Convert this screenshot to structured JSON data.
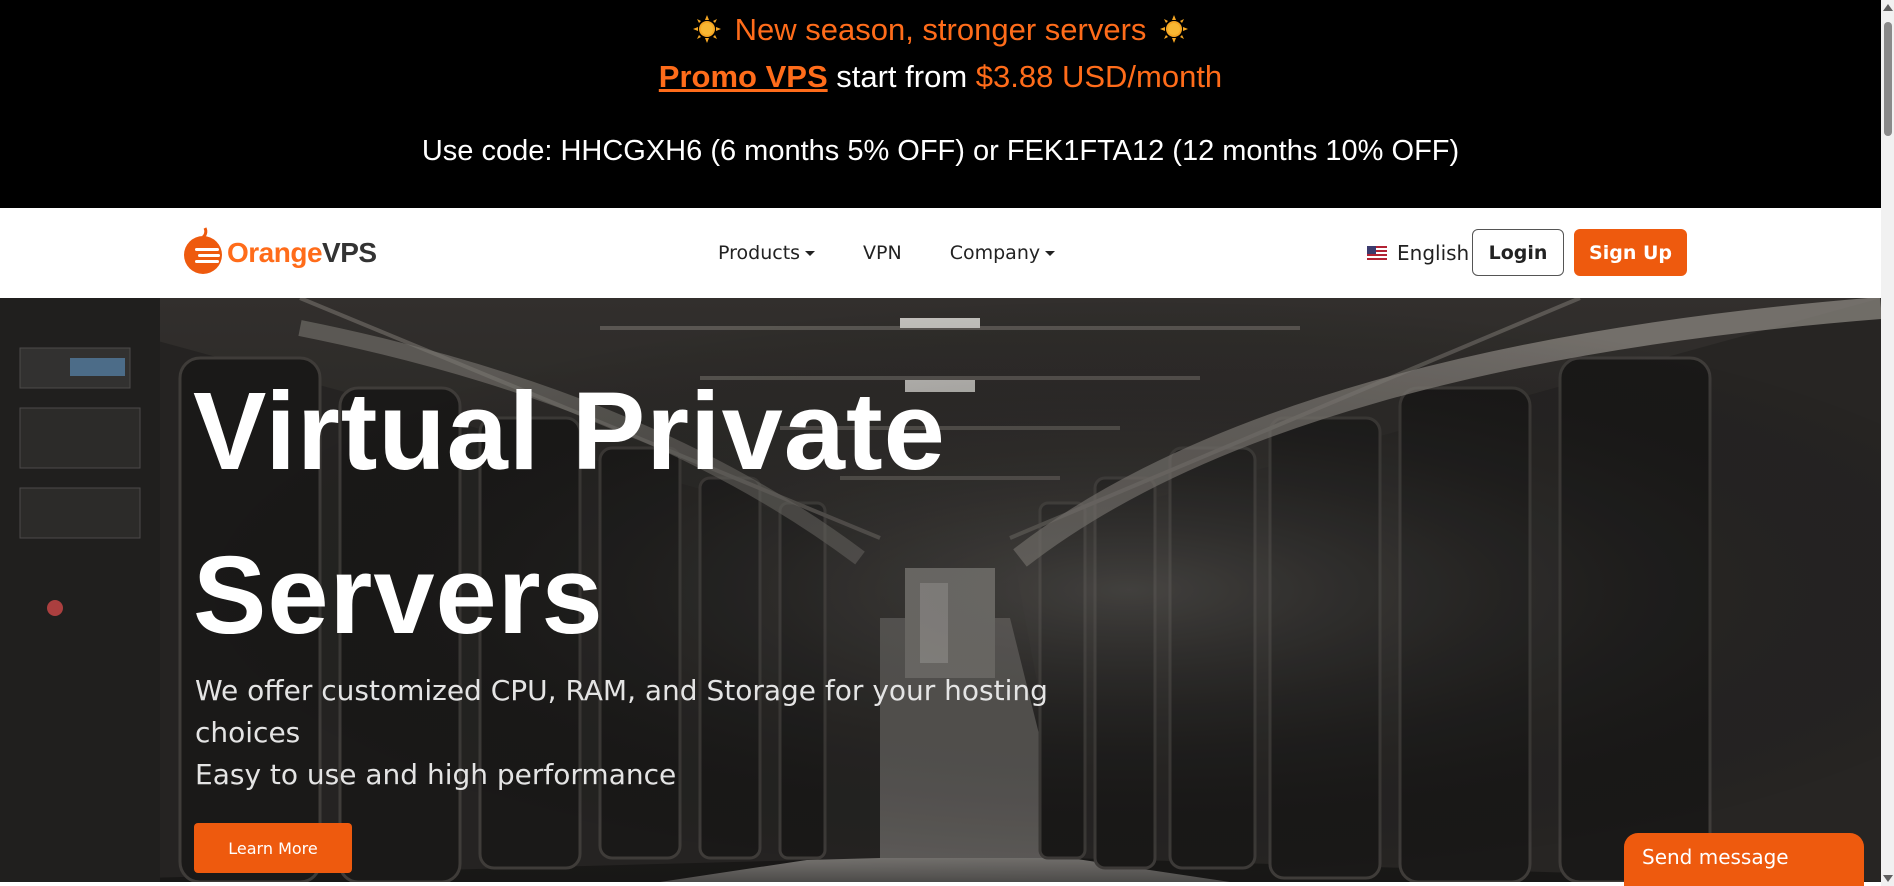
{
  "promo": {
    "headline": "New season, stronger servers",
    "promo_link": "Promo VPS",
    "middle_text": " start from ",
    "price": "$3.88 USD/month",
    "code_line": "Use code: HHCGXH6 (6 months 5% OFF) or FEK1FTA12 (12 months 10% OFF)",
    "icon_left": "sun-icon",
    "icon_right": "sun-icon"
  },
  "navbar": {
    "logo": {
      "part1": "Orange",
      "part2": "VPS"
    },
    "links": [
      {
        "label": "Products",
        "dropdown": true
      },
      {
        "label": "VPN",
        "dropdown": false
      },
      {
        "label": "Company",
        "dropdown": true
      }
    ],
    "language": {
      "label": "English",
      "flag": "us-flag-icon"
    },
    "login_label": "Login",
    "signup_label": "Sign Up"
  },
  "hero": {
    "title_line1": "Virtual Private",
    "title_line2": "Servers",
    "sub_line1": "We offer customized CPU, RAM, and Storage for your hosting",
    "sub_line2": "choices",
    "sub_line3": "Easy to use and high performance",
    "cta_label": "Learn More"
  },
  "chat": {
    "label": "Send message"
  },
  "colors": {
    "accent": "#ee5a0e",
    "promo_orange": "#ff6c1a",
    "banner_bg": "#000000"
  }
}
